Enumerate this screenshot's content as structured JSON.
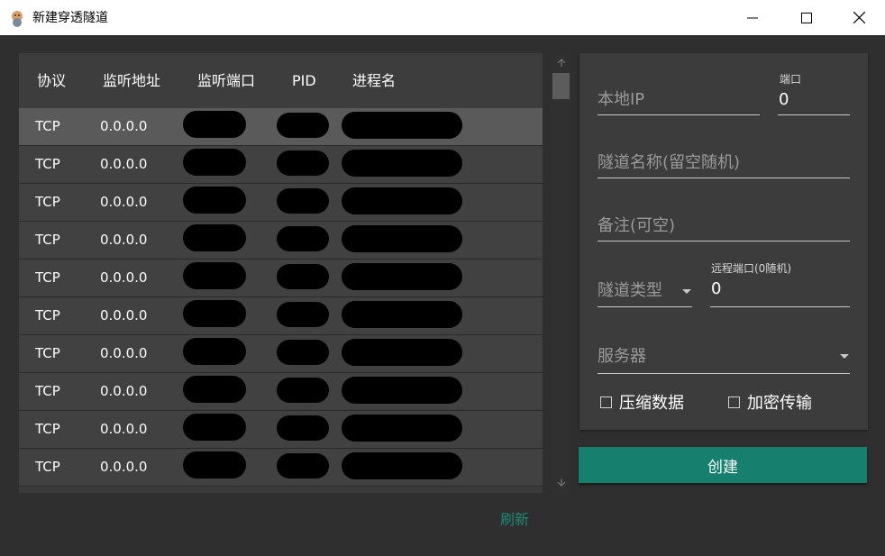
{
  "window": {
    "title": "新建穿透隧道",
    "icon": "app-mascot-icon",
    "controls": [
      "minimize-icon",
      "maximize-icon",
      "close-icon"
    ]
  },
  "table": {
    "headers": [
      "协议",
      "监听地址",
      "监听端口",
      "PID",
      "进程名"
    ],
    "rows": [
      {
        "protocol": "TCP",
        "address": "0.0.0.0",
        "selected": true
      },
      {
        "protocol": "TCP",
        "address": "0.0.0.0"
      },
      {
        "protocol": "TCP",
        "address": "0.0.0.0"
      },
      {
        "protocol": "TCP",
        "address": "0.0.0.0"
      },
      {
        "protocol": "TCP",
        "address": "0.0.0.0"
      },
      {
        "protocol": "TCP",
        "address": "0.0.0.0"
      },
      {
        "protocol": "TCP",
        "address": "0.0.0.0"
      },
      {
        "protocol": "TCP",
        "address": "0.0.0.0"
      },
      {
        "protocol": "TCP",
        "address": "0.0.0.0"
      },
      {
        "protocol": "TCP",
        "address": "0.0.0.0"
      }
    ]
  },
  "refresh_label": "刷新",
  "form": {
    "local_ip_placeholder": "本地IP",
    "port_label": "端口",
    "port_value": "0",
    "tunnel_name_placeholder": "隧道名称(留空随机)",
    "remark_placeholder": "备注(可空)",
    "tunnel_type_placeholder": "隧道类型",
    "remote_port_label": "远程端口(0随机)",
    "remote_port_value": "0",
    "server_placeholder": "服务器",
    "compress_label": "压缩数据",
    "encrypt_label": "加密传输"
  },
  "create_label": "创建",
  "colors": {
    "accent": "#167f6e",
    "link": "#1e8a7a",
    "background": "#2f2f2f",
    "panel": "#3c3c3c"
  }
}
